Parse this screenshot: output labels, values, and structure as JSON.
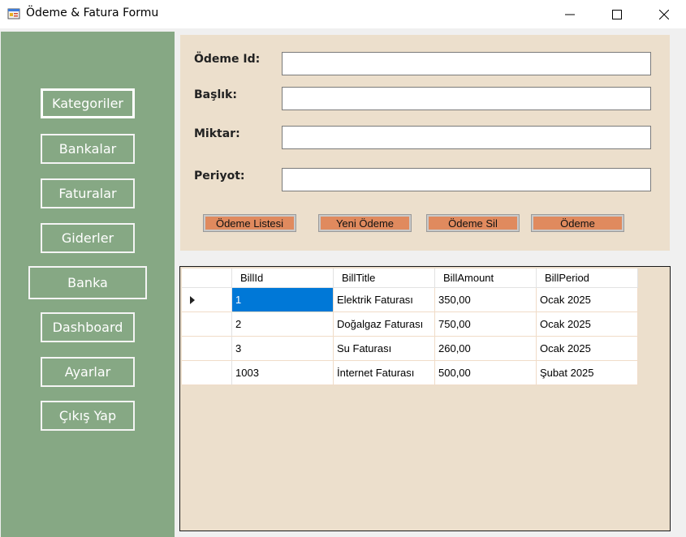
{
  "window": {
    "title": "Ödeme & Fatura Formu",
    "icon": "winforms-app-icon",
    "controls": [
      "minimize-icon",
      "maximize-icon",
      "close-icon"
    ]
  },
  "sidebar": {
    "background": "#86a884",
    "items": [
      {
        "label": "Kategoriler",
        "active": true
      },
      {
        "label": "Bankalar"
      },
      {
        "label": "Faturalar"
      },
      {
        "label": "Giderler"
      },
      {
        "label": "Banka"
      },
      {
        "label": "Dashboard"
      },
      {
        "label": "Ayarlar"
      },
      {
        "label": "Çıkış Yap"
      }
    ]
  },
  "form": {
    "background": "#ecdfcc",
    "fields": [
      {
        "label": "Ödeme Id:",
        "value": ""
      },
      {
        "label": "Başlık:",
        "value": ""
      },
      {
        "label": "Miktar:",
        "value": ""
      },
      {
        "label": "Periyot:",
        "value": ""
      }
    ],
    "buttons": [
      {
        "label": "Ödeme Listesi"
      },
      {
        "label": "Yeni Ödeme"
      },
      {
        "label": "Ödeme Sil"
      },
      {
        "label": "Ödeme"
      }
    ],
    "button_color": "#e08a5e"
  },
  "grid": {
    "columns": [
      "BillId",
      "BillTitle",
      "BillAmount",
      "BillPeriod"
    ],
    "rows": [
      {
        "id": "1",
        "title": "Elektrik Faturası",
        "amount": "350,00",
        "period": "Ocak 2025",
        "current": true
      },
      {
        "id": "2",
        "title": "Doğalgaz Faturası",
        "amount": "750,00",
        "period": "Ocak 2025"
      },
      {
        "id": "3",
        "title": "Su Faturası",
        "amount": "260,00",
        "period": "Ocak 2025"
      },
      {
        "id": "1003",
        "title": "İnternet Faturası",
        "amount": "500,00",
        "period": "Şubat 2025"
      }
    ],
    "selection_color": "#0078d7"
  }
}
